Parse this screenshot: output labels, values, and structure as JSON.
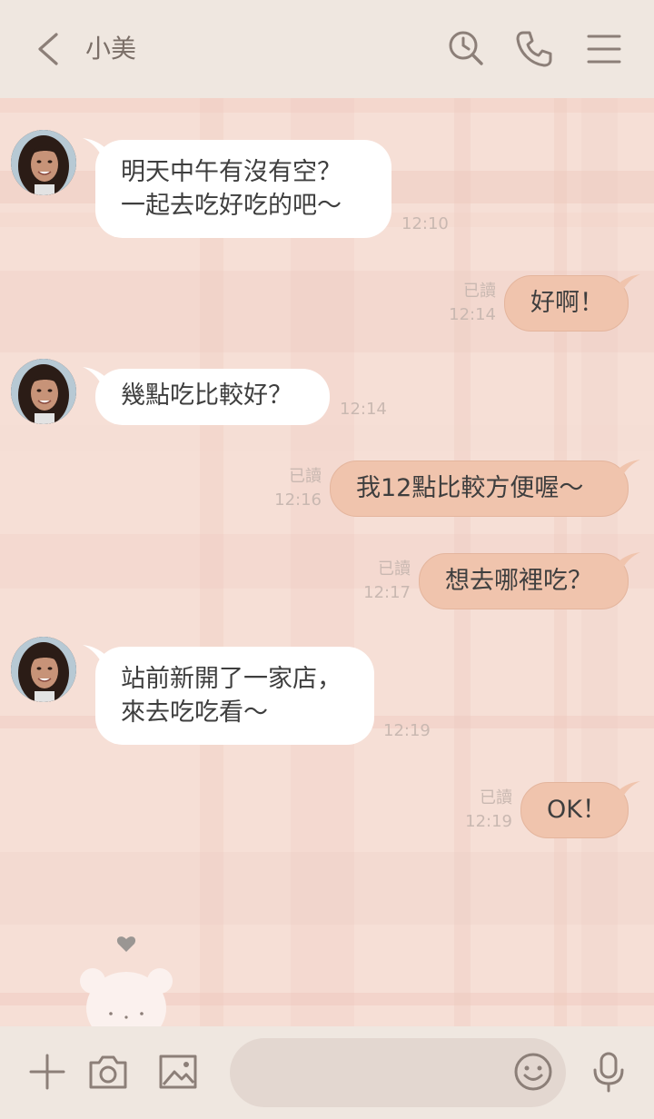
{
  "header": {
    "contact_name": "小美",
    "icons": [
      "back-chevron-icon",
      "search-history-icon",
      "phone-icon",
      "menu-icon"
    ]
  },
  "messages": [
    {
      "side": "in",
      "lines": [
        "明天中午有沒有空？",
        "一起去吃好吃的吧～"
      ],
      "time": "12:10"
    },
    {
      "side": "out",
      "lines": [
        "好啊！"
      ],
      "read": "已讀",
      "time": "12:14"
    },
    {
      "side": "in",
      "lines": [
        "幾點吃比較好？"
      ],
      "time": "12:14"
    },
    {
      "side": "out",
      "lines": [
        "我12點比較方便喔～"
      ],
      "read": "已讀",
      "time": "12:16"
    },
    {
      "side": "out",
      "lines": [
        "想去哪裡吃？"
      ],
      "read": "已讀",
      "time": "12:17"
    },
    {
      "side": "in",
      "lines": [
        "站前新開了一家店，",
        "來去吃吃看～"
      ],
      "time": "12:19"
    },
    {
      "side": "out",
      "lines": [
        "OK！"
      ],
      "read": "已讀",
      "time": "12:19"
    }
  ],
  "input_bar": {
    "icons": [
      "plus-icon",
      "camera-icon",
      "image-icon",
      "emoji-icon",
      "microphone-icon"
    ],
    "placeholder": ""
  },
  "theme": {
    "bubble_in": "#ffffff",
    "bubble_out": "#f0c4ad",
    "background": "#f6dfd6",
    "header": "#efe7e0"
  }
}
